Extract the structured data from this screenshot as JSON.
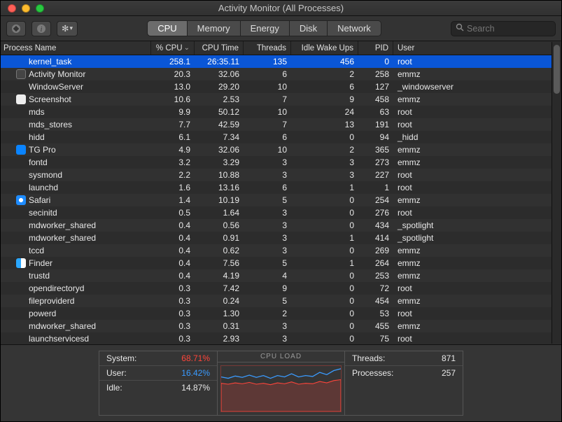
{
  "window": {
    "title": "Activity Monitor (All Processes)"
  },
  "toolbar": {
    "search_placeholder": "Search",
    "tabs": [
      "CPU",
      "Memory",
      "Energy",
      "Disk",
      "Network"
    ],
    "active_tab": 0
  },
  "columns": {
    "name": "Process Name",
    "cpu": "% CPU",
    "time": "CPU Time",
    "threads": "Threads",
    "idle": "Idle Wake Ups",
    "pid": "PID",
    "user": "User"
  },
  "processes": [
    {
      "name": "kernel_task",
      "icon": "",
      "cpu": "258.1",
      "time": "26:35.11",
      "threads": "135",
      "idle": "456",
      "pid": "0",
      "user": "root",
      "selected": true
    },
    {
      "name": "Activity Monitor",
      "icon": "monitor",
      "cpu": "20.3",
      "time": "32.06",
      "threads": "6",
      "idle": "2",
      "pid": "258",
      "user": "emmz"
    },
    {
      "name": "WindowServer",
      "icon": "",
      "cpu": "13.0",
      "time": "29.20",
      "threads": "10",
      "idle": "6",
      "pid": "127",
      "user": "_windowserver"
    },
    {
      "name": "Screenshot",
      "icon": "shot",
      "cpu": "10.6",
      "time": "2.53",
      "threads": "7",
      "idle": "9",
      "pid": "458",
      "user": "emmz"
    },
    {
      "name": "mds",
      "icon": "",
      "cpu": "9.9",
      "time": "50.12",
      "threads": "10",
      "idle": "24",
      "pid": "63",
      "user": "root"
    },
    {
      "name": "mds_stores",
      "icon": "",
      "cpu": "7.7",
      "time": "42.59",
      "threads": "7",
      "idle": "13",
      "pid": "191",
      "user": "root"
    },
    {
      "name": "hidd",
      "icon": "",
      "cpu": "6.1",
      "time": "7.34",
      "threads": "6",
      "idle": "0",
      "pid": "94",
      "user": "_hidd"
    },
    {
      "name": "TG Pro",
      "icon": "tg",
      "cpu": "4.9",
      "time": "32.06",
      "threads": "10",
      "idle": "2",
      "pid": "365",
      "user": "emmz"
    },
    {
      "name": "fontd",
      "icon": "",
      "cpu": "3.2",
      "time": "3.29",
      "threads": "3",
      "idle": "3",
      "pid": "273",
      "user": "emmz"
    },
    {
      "name": "sysmond",
      "icon": "",
      "cpu": "2.2",
      "time": "10.88",
      "threads": "3",
      "idle": "3",
      "pid": "227",
      "user": "root"
    },
    {
      "name": "launchd",
      "icon": "",
      "cpu": "1.6",
      "time": "13.16",
      "threads": "6",
      "idle": "1",
      "pid": "1",
      "user": "root"
    },
    {
      "name": "Safari",
      "icon": "safari",
      "cpu": "1.4",
      "time": "10.19",
      "threads": "5",
      "idle": "0",
      "pid": "254",
      "user": "emmz"
    },
    {
      "name": "secinitd",
      "icon": "",
      "cpu": "0.5",
      "time": "1.64",
      "threads": "3",
      "idle": "0",
      "pid": "276",
      "user": "root"
    },
    {
      "name": "mdworker_shared",
      "icon": "",
      "cpu": "0.4",
      "time": "0.56",
      "threads": "3",
      "idle": "0",
      "pid": "434",
      "user": "_spotlight"
    },
    {
      "name": "mdworker_shared",
      "icon": "",
      "cpu": "0.4",
      "time": "0.91",
      "threads": "3",
      "idle": "1",
      "pid": "414",
      "user": "_spotlight"
    },
    {
      "name": "tccd",
      "icon": "",
      "cpu": "0.4",
      "time": "0.62",
      "threads": "3",
      "idle": "0",
      "pid": "269",
      "user": "emmz"
    },
    {
      "name": "Finder",
      "icon": "finder",
      "cpu": "0.4",
      "time": "7.56",
      "threads": "5",
      "idle": "1",
      "pid": "264",
      "user": "emmz"
    },
    {
      "name": "trustd",
      "icon": "",
      "cpu": "0.4",
      "time": "4.19",
      "threads": "4",
      "idle": "0",
      "pid": "253",
      "user": "emmz"
    },
    {
      "name": "opendirectoryd",
      "icon": "",
      "cpu": "0.3",
      "time": "7.42",
      "threads": "9",
      "idle": "0",
      "pid": "72",
      "user": "root"
    },
    {
      "name": "fileproviderd",
      "icon": "",
      "cpu": "0.3",
      "time": "0.24",
      "threads": "5",
      "idle": "0",
      "pid": "454",
      "user": "emmz"
    },
    {
      "name": "powerd",
      "icon": "",
      "cpu": "0.3",
      "time": "1.30",
      "threads": "2",
      "idle": "0",
      "pid": "53",
      "user": "root"
    },
    {
      "name": "mdworker_shared",
      "icon": "",
      "cpu": "0.3",
      "time": "0.31",
      "threads": "3",
      "idle": "0",
      "pid": "455",
      "user": "emmz"
    },
    {
      "name": "launchservicesd",
      "icon": "",
      "cpu": "0.3",
      "time": "2.93",
      "threads": "3",
      "idle": "0",
      "pid": "75",
      "user": "root"
    }
  ],
  "footer": {
    "system_label": "System:",
    "system_val": "68.71%",
    "user_label": "User:",
    "user_val": "16.42%",
    "idle_label": "Idle:",
    "idle_val": "14.87%",
    "chart_title": "CPU LOAD",
    "threads_label": "Threads:",
    "threads_val": "871",
    "procs_label": "Processes:",
    "procs_val": "257"
  },
  "chart_data": {
    "type": "area",
    "title": "CPU LOAD",
    "series": [
      {
        "name": "System",
        "color": "#ff453a",
        "values": [
          62,
          60,
          63,
          61,
          64,
          60,
          62,
          59,
          63,
          61,
          65,
          60,
          62,
          61,
          66,
          63,
          68,
          70
        ]
      },
      {
        "name": "User",
        "color": "#3a9bff",
        "values": [
          14,
          13,
          15,
          14,
          16,
          15,
          17,
          14,
          16,
          15,
          18,
          16,
          17,
          16,
          20,
          18,
          22,
          24
        ]
      }
    ],
    "ylim": [
      0,
      100
    ]
  }
}
